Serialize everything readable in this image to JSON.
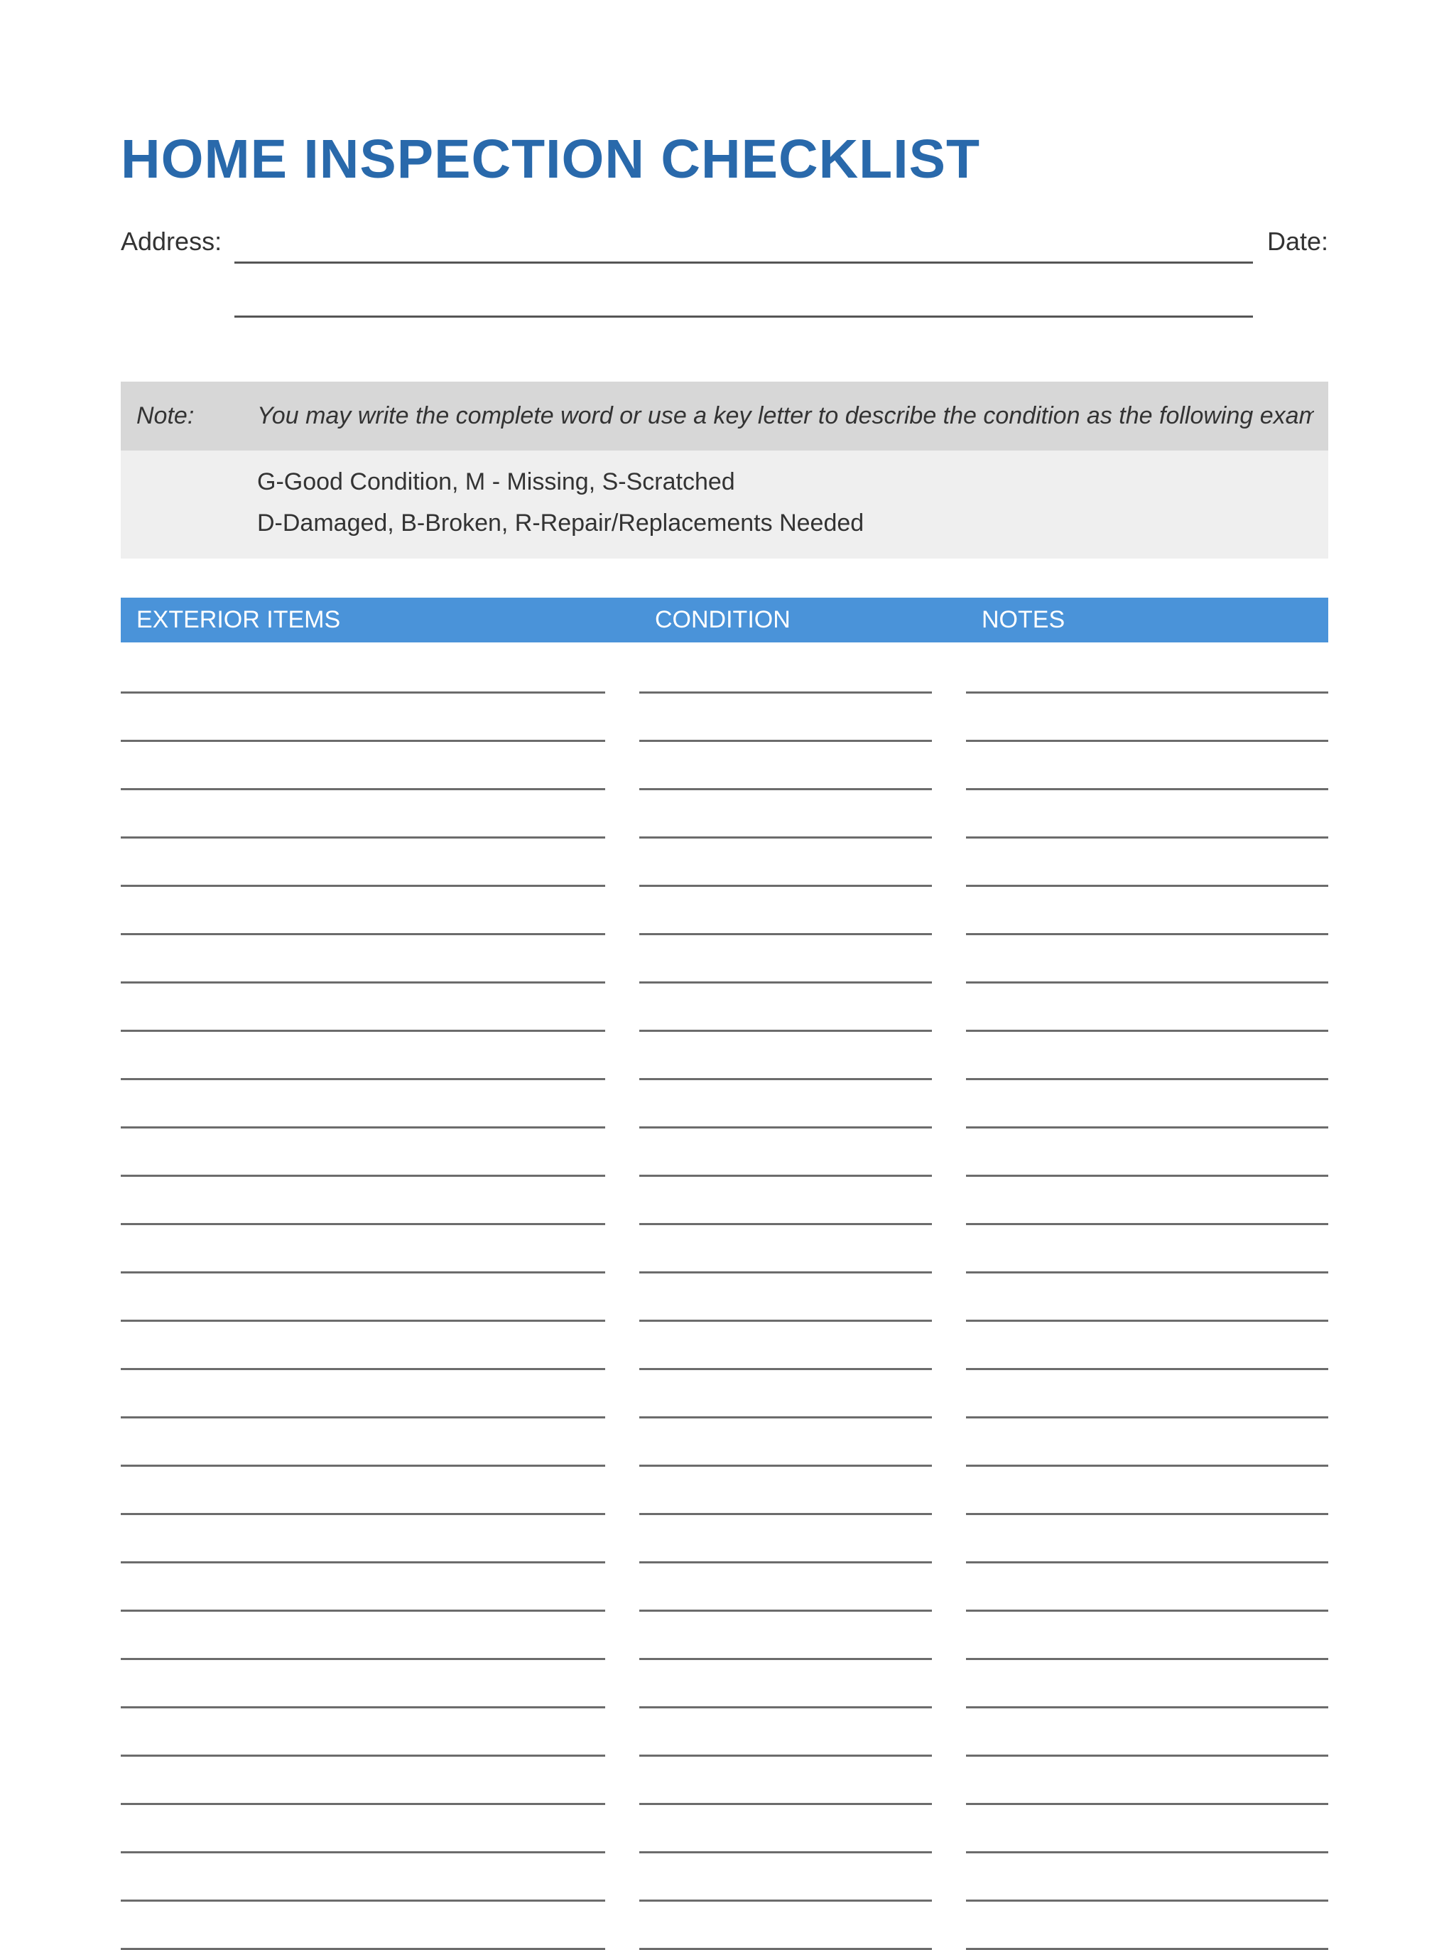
{
  "title": "HOME INSPECTION CHECKLIST",
  "labels": {
    "address": "Address:",
    "date": "Date:"
  },
  "note": {
    "label": "Note:",
    "text": "You may write the complete word or use a key letter to describe the condition as the following examples.",
    "key1": "G-Good Condition, M - Missing, S-Scratched",
    "key2": "D-Damaged, B-Broken, R-Repair/Replacements Needed"
  },
  "headers": {
    "items": "EXTERIOR ITEMS",
    "condition": "CONDITION",
    "notes": "NOTES"
  },
  "row_count": 27
}
